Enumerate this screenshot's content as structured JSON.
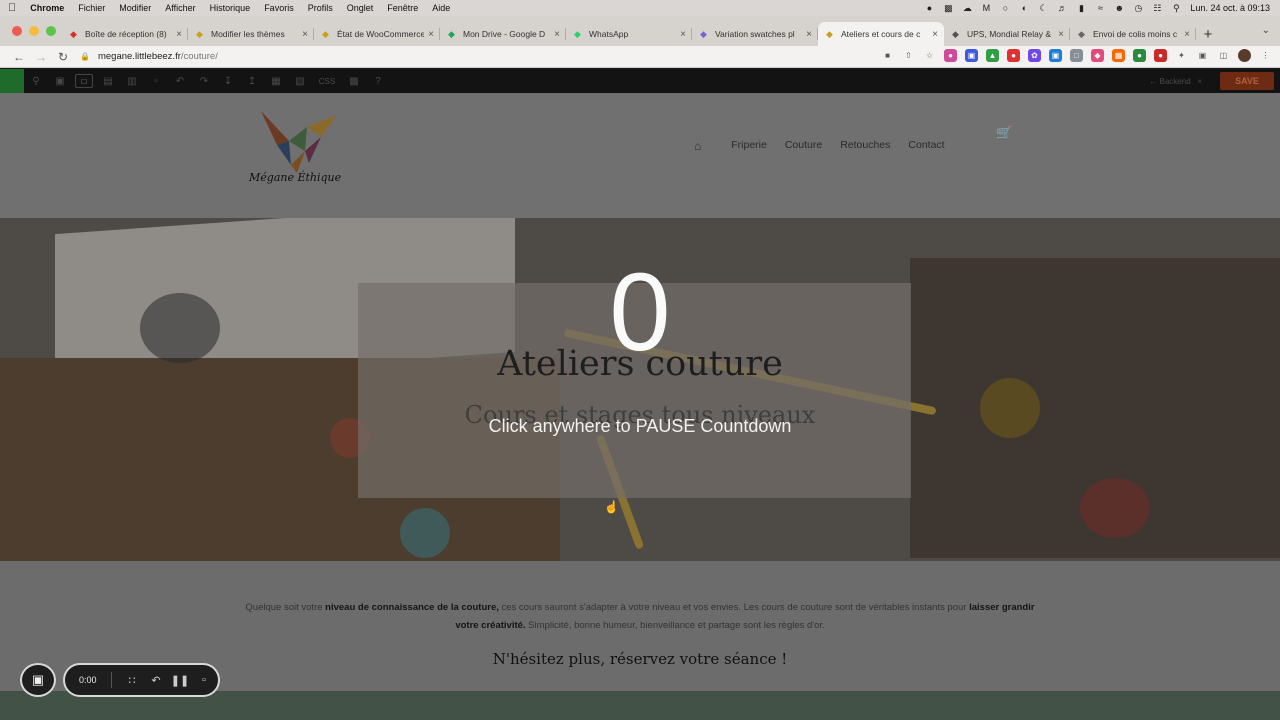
{
  "menubar": {
    "app": "Chrome",
    "items": [
      "Fichier",
      "Modifier",
      "Afficher",
      "Historique",
      "Favoris",
      "Profils",
      "Onglet",
      "Fenêtre",
      "Aide"
    ],
    "datetime": "Lun. 24 oct. à 09:13"
  },
  "tabs": [
    {
      "label": "Boîte de réception (8)",
      "icon": "gmail-icon",
      "color": "#d93025"
    },
    {
      "label": "Modifier les thèmes",
      "icon": "yoast-icon",
      "color": "#c8a020"
    },
    {
      "label": "État de WooCommerce",
      "icon": "yoast-icon",
      "color": "#c8a020"
    },
    {
      "label": "Mon Drive - Google D",
      "icon": "drive-icon",
      "color": "#1fa463"
    },
    {
      "label": "WhatsApp",
      "icon": "whatsapp-icon",
      "color": "#25d366"
    },
    {
      "label": "Variation swatches pl",
      "icon": "plugin-icon",
      "color": "#7b5fd6"
    },
    {
      "label": "Ateliers et cours de c",
      "icon": "yoast-icon",
      "color": "#c8a020",
      "active": true
    },
    {
      "label": "UPS, Mondial Relay &",
      "icon": "wordpress-icon",
      "color": "#555555"
    },
    {
      "label": "Envoi de colis moins c",
      "icon": "link-icon",
      "color": "#666666"
    }
  ],
  "address": {
    "domain": "megane.littlebeez.fr",
    "path": "/couture/"
  },
  "builder": {
    "css_label": "CSS",
    "backend_label": "Backend",
    "save_label": "SAVE"
  },
  "site": {
    "brand": "Mégane Éthique",
    "nav": [
      "Friperie",
      "Couture",
      "Retouches",
      "Contact"
    ],
    "hero_title": "Ateliers couture",
    "hero_subtitle": "Cours et stages tous niveaux",
    "intro_1": "Quelque soit votre ",
    "intro_bold_1": "niveau de connaissance de la couture,",
    "intro_2": " ces cours sauront s'adapter à votre niveau et vos envies. Les cours de couture sont de véritables instants pour ",
    "intro_bold_2": "laisser grandir votre créativité.",
    "intro_3": " Simplicité, bonne humeur, bienveillance et partage sont les règles d'or.",
    "cta": "N'hésitez plus, réservez votre séance !"
  },
  "overlay": {
    "count": "0",
    "message": "Click anywhere to PAUSE Countdown"
  },
  "recorder": {
    "time": "0:00"
  },
  "colors": {
    "save_button": "#6e2a12",
    "footer_band": "#425247"
  }
}
